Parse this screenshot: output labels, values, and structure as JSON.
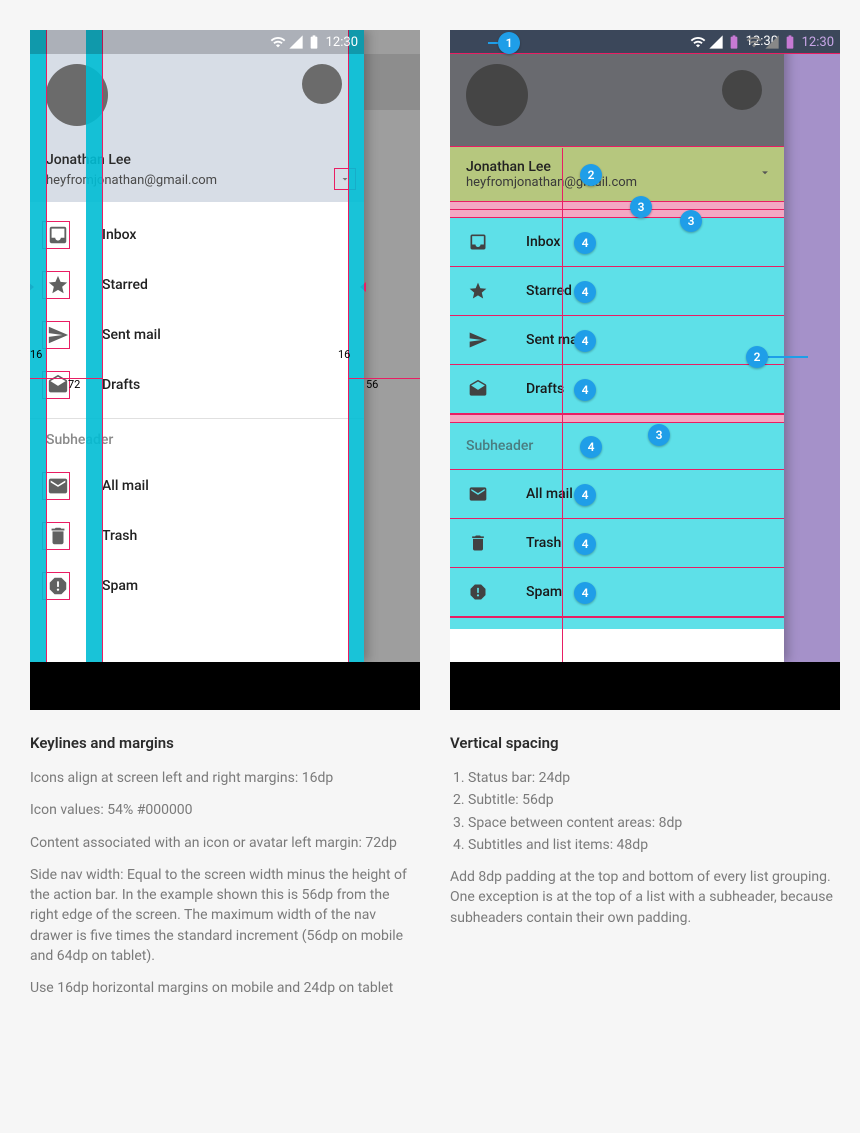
{
  "status": {
    "time": "12:30"
  },
  "user": {
    "name": "Jonathan Lee",
    "email": "heyfromjonathan@gmail.com"
  },
  "nav": {
    "group1": [
      {
        "icon": "inbox",
        "label": "Inbox"
      },
      {
        "icon": "star",
        "label": "Starred"
      },
      {
        "icon": "send",
        "label": "Sent mail"
      },
      {
        "icon": "drafts",
        "label": "Drafts"
      }
    ],
    "subheader": "Subheader",
    "group2": [
      {
        "icon": "mail",
        "label": "All mail"
      },
      {
        "icon": "trash",
        "label": "Trash"
      },
      {
        "icon": "spam",
        "label": "Spam"
      }
    ]
  },
  "dims": {
    "margin_left": "16",
    "margin_content": "72",
    "margin_right": "56"
  },
  "callouts": {
    "c1": "1",
    "c2": "2",
    "c3": "3",
    "c4": "4"
  },
  "left_caption": {
    "title": "Keylines and margins",
    "p1": "Icons align at screen left and right margins: 16dp",
    "p2": "Icon values: 54% #000000",
    "p3": "Content associated with an icon or avatar left margin: 72dp",
    "p4": "Side nav width: Equal to the screen width minus the height of the action bar. In the example shown this is 56dp from the right edge of the screen. The maximum width of the nav drawer is five times the standard increment (56dp on mobile and 64dp on tablet).",
    "p5": "Use 16dp horizontal margins on mobile and 24dp on tablet"
  },
  "right_caption": {
    "title": "Vertical spacing",
    "li1": "Status bar: 24dp",
    "li2": "Subtitle: 56dp",
    "li3": "Space between content areas: 8dp",
    "li4": "Subtitles and list items: 48dp",
    "p1": "Add 8dp padding at the top and bottom of every list grouping. One exception is at the top of a list with a subheader, because subheaders contain their own padding."
  }
}
